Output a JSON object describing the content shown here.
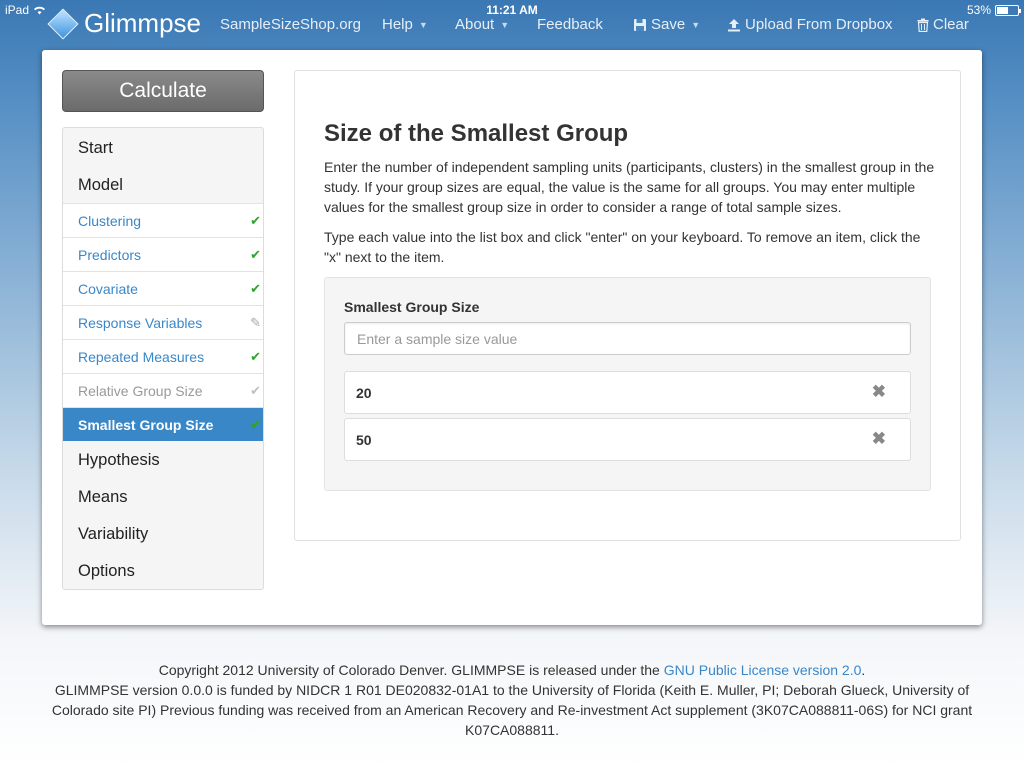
{
  "statusbar": {
    "carrier": "iPad",
    "time": "11:21 AM",
    "battery": "53%",
    "battery_level": 0.53
  },
  "navbar": {
    "brand": "Glimmpse",
    "items": [
      {
        "label": "SampleSizeShop.org"
      },
      {
        "label": "Help"
      },
      {
        "label": "About"
      },
      {
        "label": "Feedback"
      },
      {
        "label": "Save"
      },
      {
        "label": "Upload From Dropbox"
      },
      {
        "label": "Clear"
      }
    ]
  },
  "calculate_label": "Calculate",
  "sidebar": {
    "items": [
      {
        "label": "Start"
      },
      {
        "label": "Model"
      },
      {
        "label": "Clustering",
        "status": "check"
      },
      {
        "label": "Predictors",
        "status": "check"
      },
      {
        "label": "Covariate",
        "status": "check"
      },
      {
        "label": "Response Variables",
        "status": "pencil"
      },
      {
        "label": "Repeated Measures",
        "status": "check"
      },
      {
        "label": "Relative Group Size",
        "status": "check-disabled"
      },
      {
        "label": "Smallest Group Size",
        "status": "check"
      },
      {
        "label": "Hypothesis"
      },
      {
        "label": "Means"
      },
      {
        "label": "Variability"
      },
      {
        "label": "Options"
      }
    ]
  },
  "main": {
    "title": "Size of the Smallest Group",
    "para1": "Enter the number of independent sampling units (participants, clusters) in the smallest group in the study. If your group sizes are equal, the value is the same for all groups. You may enter multiple values for the smallest group size in order to consider a range of total sample sizes.",
    "para2": "Type each value into the list box and click \"enter\" on your keyboard. To remove an item, click the \"x\" next to the item.",
    "field_label": "Smallest Group Size",
    "input_placeholder": "Enter a sample size value",
    "input_value": "",
    "values": [
      "20",
      "50"
    ]
  },
  "footer": {
    "line1_pre": "Copyright 2012 University of Colorado Denver. GLIMMPSE is released under the ",
    "line1_link": "GNU Public License version 2.0",
    "line1_post": ".",
    "line2": "GLIMMPSE version 0.0.0 is funded by NIDCR 1 R01 DE020832-01A1 to the University of Florida (Keith E. Muller, PI; Deborah Glueck, University of Colorado site PI) Previous funding was received from an American Recovery and Re-investment Act supplement (3K07CA088811-06S) for NCI grant K07CA088811."
  },
  "colors": {
    "nav_bg": "#3a78b4",
    "link": "#3a87c8",
    "active": "#3a87c8",
    "check": "#2ea22e"
  }
}
